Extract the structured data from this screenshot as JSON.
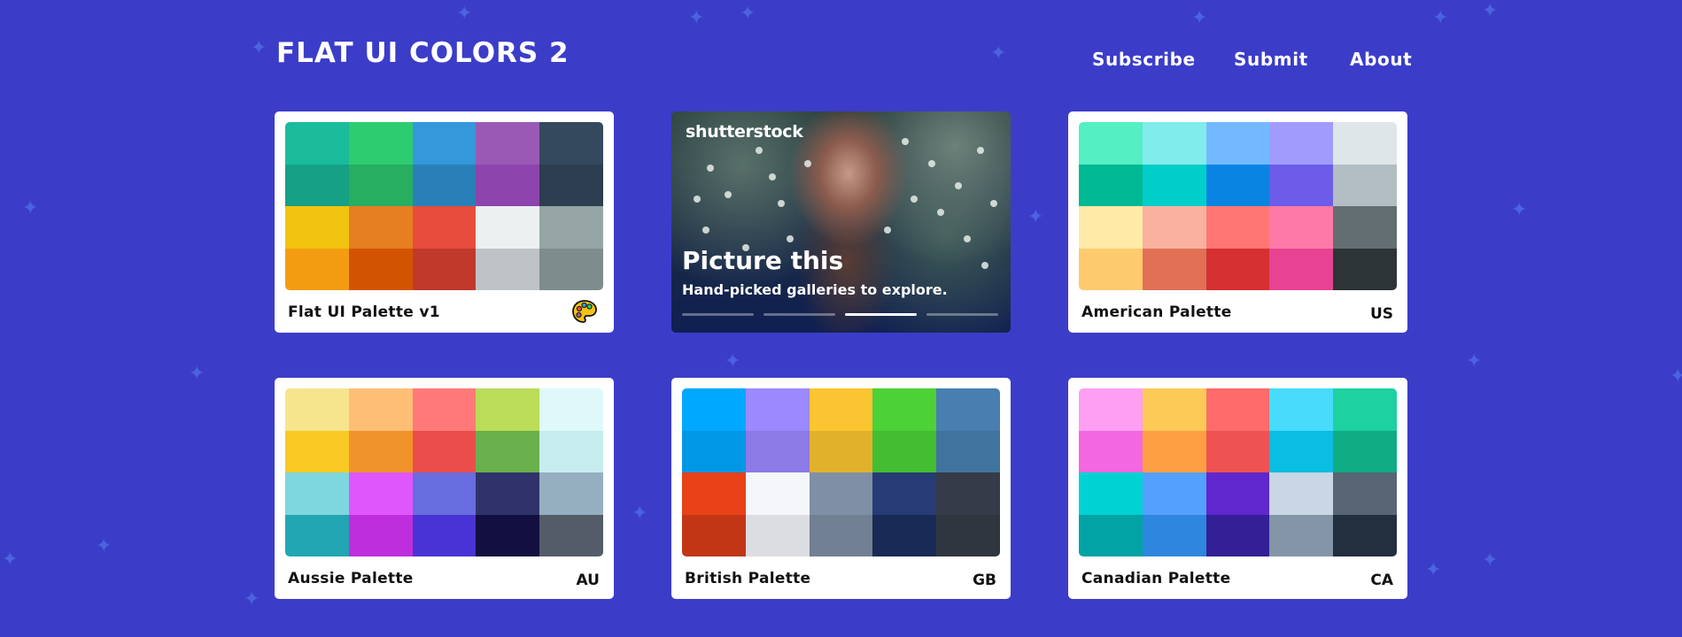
{
  "header": {
    "title": "FLAT UI COLORS 2",
    "nav": [
      "Subscribe",
      "Submit",
      "About"
    ]
  },
  "ad": {
    "logo": "shutterstock",
    "title": "Picture this",
    "subtitle": "Hand-picked galleries to explore.",
    "slide_count": 4,
    "active_slide": 3
  },
  "palettes": [
    {
      "name": "Flat UI Palette v1",
      "code": "",
      "icon": "palette-icon",
      "colors": [
        "#1abc9c",
        "#2ecc71",
        "#3498db",
        "#9b59b6",
        "#34495e",
        "#16a085",
        "#27ae60",
        "#2980b9",
        "#8e44ad",
        "#2c3e50",
        "#f1c40f",
        "#e67e22",
        "#e74c3c",
        "#ecf0f1",
        "#95a5a6",
        "#f39c12",
        "#d35400",
        "#c0392b",
        "#bdc3c7",
        "#7f8c8d"
      ]
    },
    {
      "name": "American Palette",
      "code": "US",
      "colors": [
        "#55efc4",
        "#81ecec",
        "#74b9ff",
        "#a29bfe",
        "#dfe6e9",
        "#00b894",
        "#00cec9",
        "#0984e3",
        "#6c5ce7",
        "#b2bec3",
        "#ffeaa7",
        "#fab1a0",
        "#ff7675",
        "#fd79a8",
        "#636e72",
        "#fdcb6e",
        "#e17055",
        "#d63031",
        "#e84393",
        "#2d3436"
      ]
    },
    {
      "name": "Aussie Palette",
      "code": "AU",
      "colors": [
        "#f6e58d",
        "#ffbe76",
        "#ff7979",
        "#badc58",
        "#dff9fb",
        "#f9ca24",
        "#f0932b",
        "#eb4d4b",
        "#6ab04c",
        "#c7ecee",
        "#7ed6df",
        "#e056fd",
        "#686de0",
        "#30336b",
        "#95afc0",
        "#22a6b3",
        "#be2edd",
        "#4834d4",
        "#130f40",
        "#535c68"
      ]
    },
    {
      "name": "British Palette",
      "code": "GB",
      "colors": [
        "#00a8ff",
        "#9c88ff",
        "#fbc531",
        "#4cd137",
        "#487eb0",
        "#0097e6",
        "#8c7ae6",
        "#e1b12c",
        "#44bd32",
        "#40739e",
        "#e84118",
        "#f5f6fa",
        "#7f8fa6",
        "#273c75",
        "#353b48",
        "#c23616",
        "#dcdde1",
        "#718093",
        "#192a56",
        "#2f3640"
      ]
    },
    {
      "name": "Canadian Palette",
      "code": "CA",
      "colors": [
        "#ff9ff3",
        "#feca57",
        "#ff6b6b",
        "#48dbfb",
        "#1dd1a1",
        "#f368e0",
        "#ff9f43",
        "#ee5253",
        "#0abde3",
        "#10ac84",
        "#00d2d3",
        "#54a0ff",
        "#5f27cd",
        "#c8d6e5",
        "#576574",
        "#01a3a4",
        "#2e86de",
        "#341f97",
        "#8395a7",
        "#222f3e"
      ]
    }
  ]
}
